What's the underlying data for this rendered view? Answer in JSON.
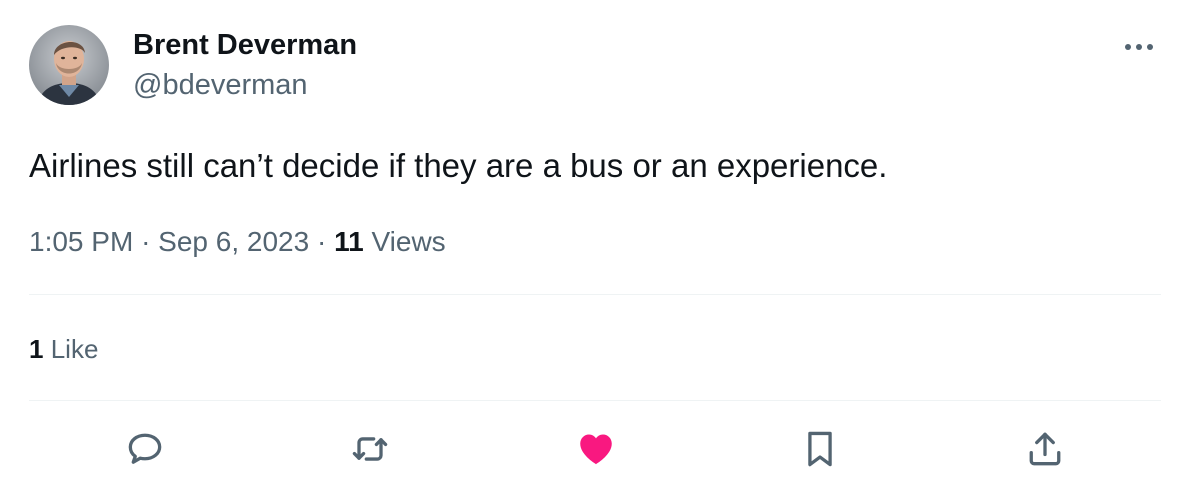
{
  "author": {
    "display_name": "Brent Deverman",
    "handle": "@bdeverman",
    "avatar_icon": "person-photo-avatar"
  },
  "header": {
    "more_icon": "more-horizontal-icon"
  },
  "tweet": {
    "text": "Airlines still can’t decide if they are a bus or an experience."
  },
  "meta": {
    "time": "1:05 PM",
    "separator": "·",
    "date": "Sep 6, 2023",
    "views_count": "11",
    "views_label": "Views"
  },
  "stats": {
    "likes_count": "1",
    "likes_label": "Like"
  },
  "actions": [
    {
      "name": "reply",
      "icon": "reply-bubble-icon"
    },
    {
      "name": "repost",
      "icon": "repost-arrows-icon"
    },
    {
      "name": "like",
      "icon": "heart-icon",
      "state": "liked"
    },
    {
      "name": "bookmark",
      "icon": "bookmark-icon"
    },
    {
      "name": "share",
      "icon": "share-upload-icon"
    }
  ],
  "colors": {
    "text_primary": "#0f1419",
    "text_secondary": "#536471",
    "divider": "#eff3f4",
    "like_active": "#f91880"
  }
}
